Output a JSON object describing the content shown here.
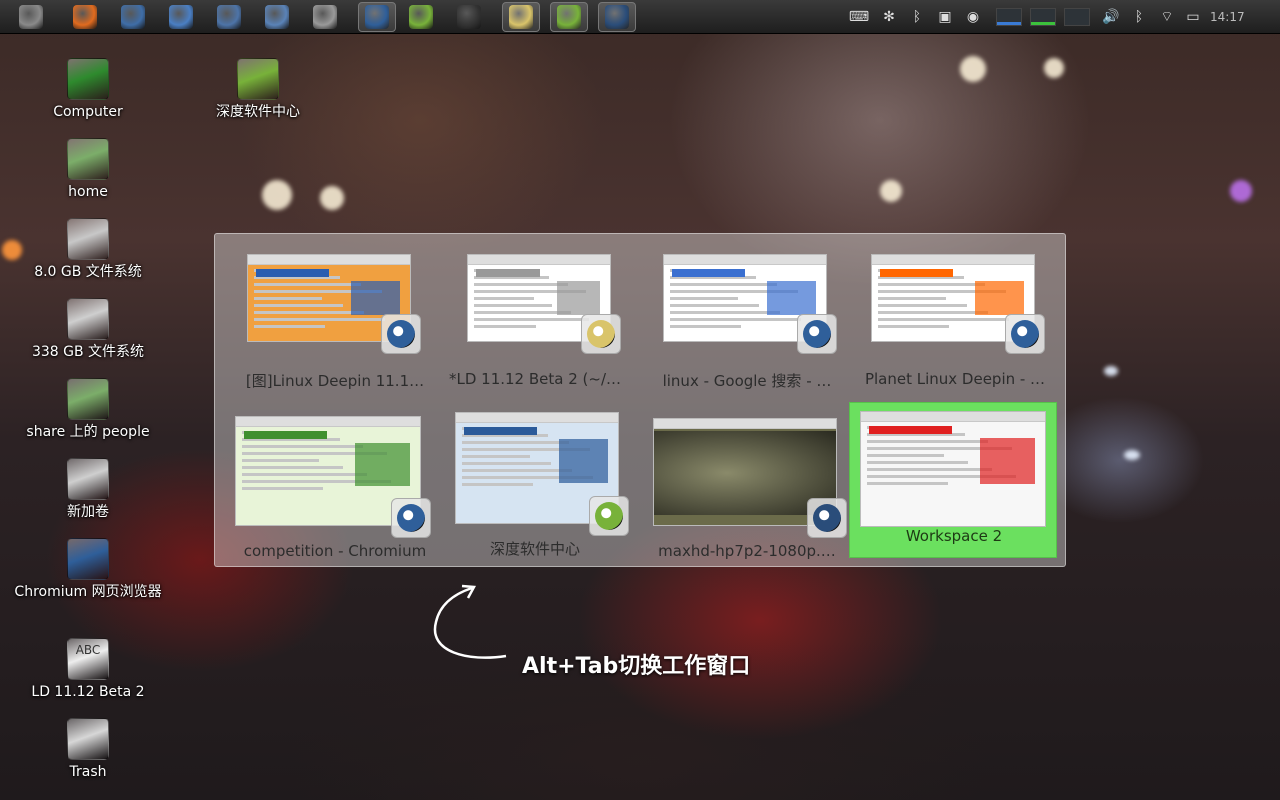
{
  "top_panel": {
    "launchers": [
      {
        "icon": "dash-icon",
        "color": "#8a8a8a"
      },
      {
        "icon": "firefox-icon",
        "color": "#e06b1f"
      },
      {
        "icon": "thunderbird-icon",
        "color": "#3f6ea8"
      },
      {
        "icon": "chat-icon",
        "color": "#4a7fc4"
      },
      {
        "icon": "image-viewer-icon",
        "color": "#4d74a8"
      },
      {
        "icon": "writer-icon",
        "color": "#5a83b8"
      },
      {
        "icon": "disk-icon",
        "color": "#9a9a9a"
      },
      {
        "icon": "chromium-icon",
        "color": "#2f5f9a"
      },
      {
        "icon": "software-center-icon",
        "color": "#78b23a"
      },
      {
        "icon": "webcam-icon",
        "color": "#333333"
      },
      {
        "icon": "text-editor-icon",
        "color": "#d9c46a"
      },
      {
        "icon": "software-center-icon",
        "color": "#78b23a"
      },
      {
        "icon": "video-player-icon",
        "color": "#2a4d7a"
      }
    ],
    "tray_icons": [
      "keyboard-icon",
      "fan-icon",
      "bluetooth-icon",
      "screenshot-icon",
      "disc-icon",
      "volume-icon",
      "bluetooth-icon",
      "wifi-icon",
      "battery-icon"
    ],
    "clock": "14:17",
    "colors": {
      "cpu_meter": "#3a7bd5",
      "net_meter": "#3cc23c"
    }
  },
  "desktop_icons": [
    {
      "label": "Computer",
      "icon": "computer-icon",
      "color": "#2e8b2e"
    },
    {
      "label": "深度软件中心",
      "icon": "software-center-icon",
      "color": "#78b23a"
    },
    {
      "label": "home",
      "icon": "home-folder-icon",
      "color": "#7cae6a"
    },
    {
      "label": "8.0 GB 文件系统",
      "icon": "usb-drive-icon",
      "color": "#c8c8c8"
    },
    {
      "label": "338 GB 文件系统",
      "icon": "hard-drive-icon",
      "color": "#cfcfcf"
    },
    {
      "label": "share 上的 people",
      "icon": "network-share-icon",
      "color": "#7cae6a"
    },
    {
      "label": "新加卷",
      "icon": "hard-drive-icon",
      "color": "#cfcfcf"
    },
    {
      "label": "Chromium 网页浏览器",
      "icon": "chromium-icon",
      "color": "#2f5f9a"
    },
    {
      "label": "LD 11.12 Beta 2",
      "icon": "text-document-icon",
      "color": "#eeeeee",
      "badge": "ABC"
    },
    {
      "label": "Trash",
      "icon": "trash-icon",
      "color": "#d7d7d7"
    }
  ],
  "switcher": {
    "windows": [
      {
        "title": "[图]Linux Deepin 11.1…",
        "app_icon": "chromium-icon"
      },
      {
        "title": "*LD 11.12 Beta 2 (~/…",
        "app_icon": "text-editor-icon"
      },
      {
        "title": "linux - Google 搜索 - …",
        "app_icon": "chromium-icon"
      },
      {
        "title": "Planet Linux Deepin - …",
        "app_icon": "chromium-icon"
      },
      {
        "title": "competition - Chromium",
        "app_icon": "chromium-icon"
      },
      {
        "title": "深度软件中心",
        "app_icon": "software-center-icon"
      },
      {
        "title": "maxhd-hp7p2-1080p.…",
        "app_icon": "video-player-icon"
      },
      {
        "title": "Workspace 2",
        "app_icon": "",
        "selected": true
      }
    ],
    "selection_color": "#6be05f"
  },
  "hint": {
    "text": "Alt+Tab切换工作窗口"
  }
}
